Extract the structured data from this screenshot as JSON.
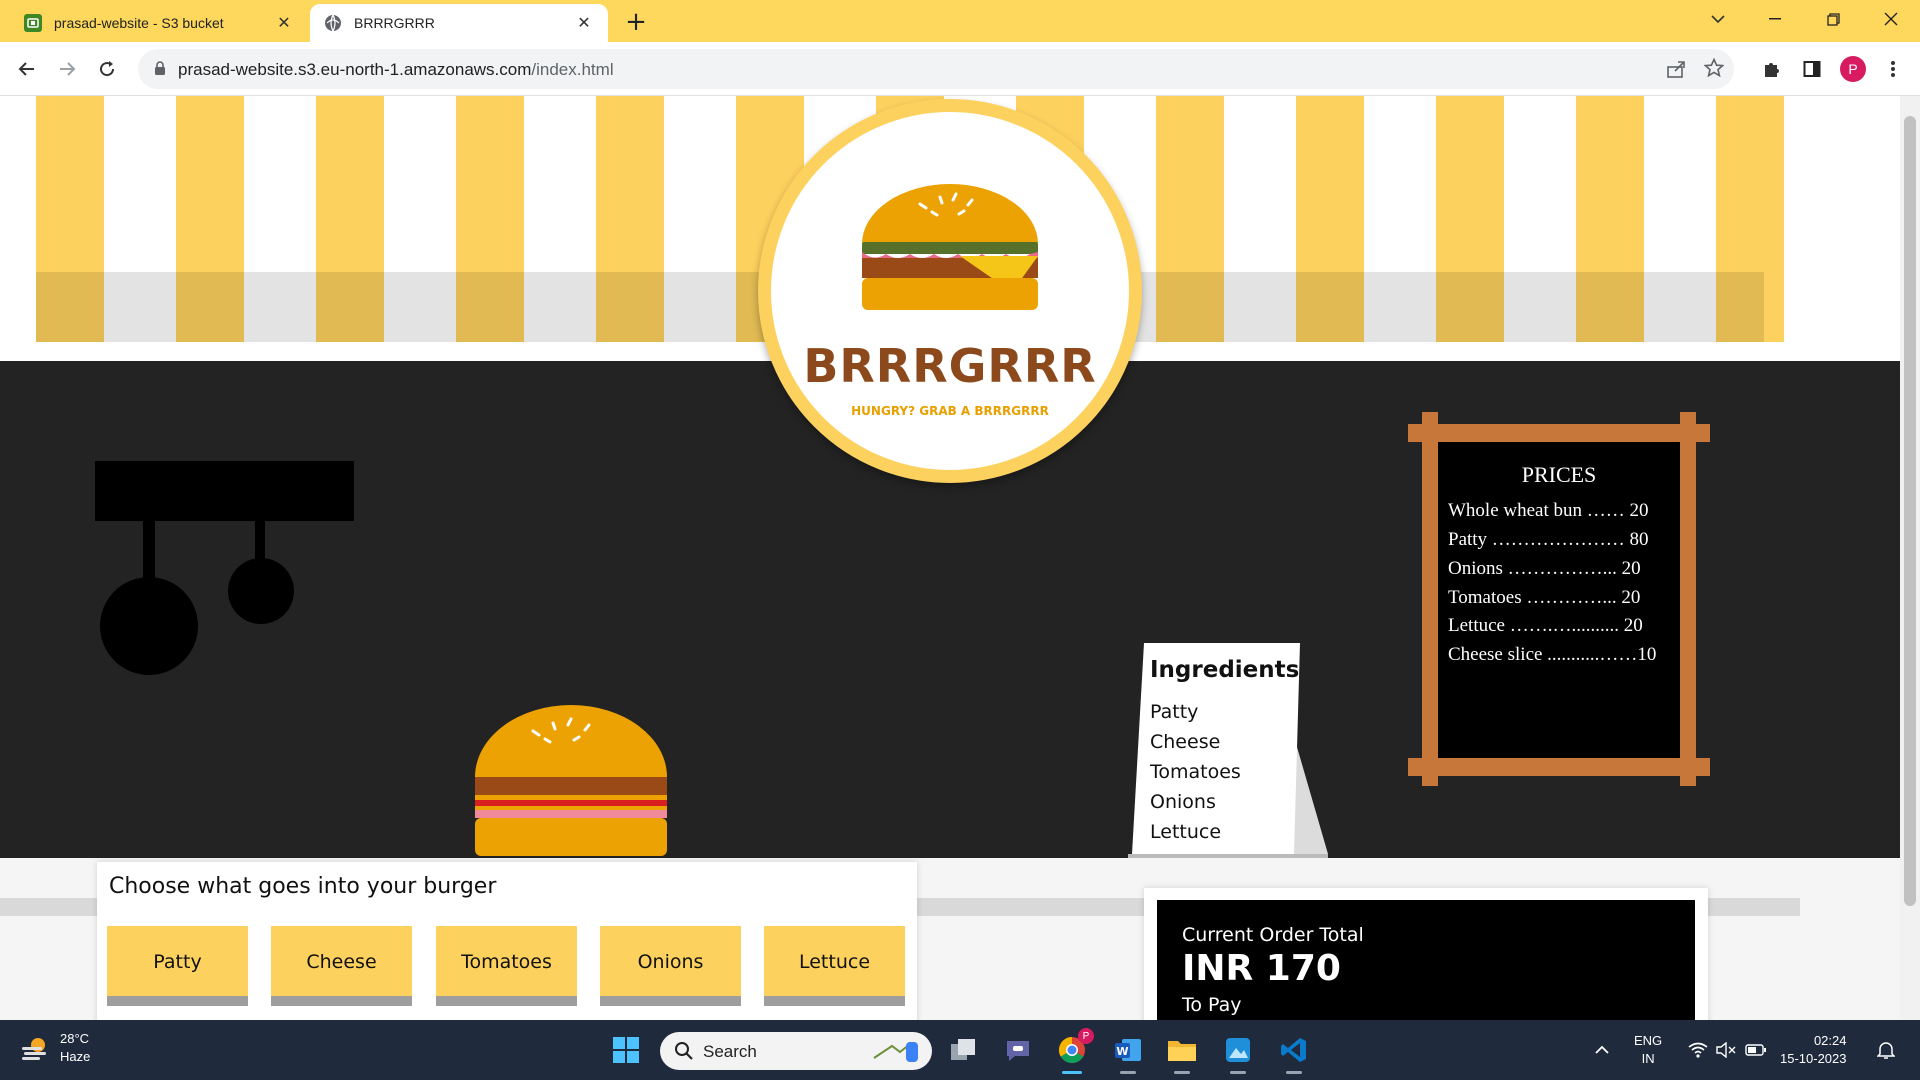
{
  "browser": {
    "tabs": [
      {
        "title": "prasad-website - S3 bucket",
        "favicon": "s3-bucket-icon",
        "active": false
      },
      {
        "title": "BRRRGRRR",
        "favicon": "globe-icon",
        "active": true
      }
    ],
    "new_tab_label": "+",
    "url_host": "prasad-website.s3.eu-north-1.amazonaws.com",
    "url_path": "/index.html",
    "profile_initial": "P",
    "colors": {
      "tabbar": "#fdd85d",
      "profile": "#d81b60"
    }
  },
  "page": {
    "logo": {
      "title": "BRRRGRRR",
      "tagline": "HUNGRY? GRAB A BRRRGRRR"
    },
    "prices_board": {
      "title": "PRICES",
      "items": [
        {
          "text": "Whole wheat bun …… 20"
        },
        {
          "text": "Patty ………………… 80"
        },
        {
          "text": "Onions ……………... 20"
        },
        {
          "text": "Tomatoes …………... 20"
        },
        {
          "text": "Lettuce …….….......... 20"
        },
        {
          "text": "Cheese slice ...........……10"
        }
      ]
    },
    "ingredients_sign": {
      "title": "Ingredients",
      "items": [
        "Patty",
        "Cheese",
        "Tomatoes",
        "Onions",
        "Lettuce"
      ]
    },
    "chooser": {
      "title": "Choose what goes into your burger",
      "buttons": [
        "Patty",
        "Cheese",
        "Tomatoes",
        "Onions",
        "Lettuce"
      ]
    },
    "order": {
      "label": "Current Order Total",
      "amount": "INR 170",
      "sublabel": "To Pay"
    },
    "colors": {
      "stripe_yellow": "#fdd15e",
      "wall": "#232323",
      "bun": "#eca203",
      "patty": "#9a4a17",
      "board_frame": "#c7773a",
      "brand_brown": "#8c4a1c"
    }
  },
  "taskbar": {
    "weather_temp": "28°C",
    "weather_desc": "Haze",
    "search_placeholder": "Search",
    "lang_line1": "ENG",
    "lang_line2": "IN",
    "time": "02:24",
    "date": "15-10-2023",
    "chrome_badge": "P"
  }
}
